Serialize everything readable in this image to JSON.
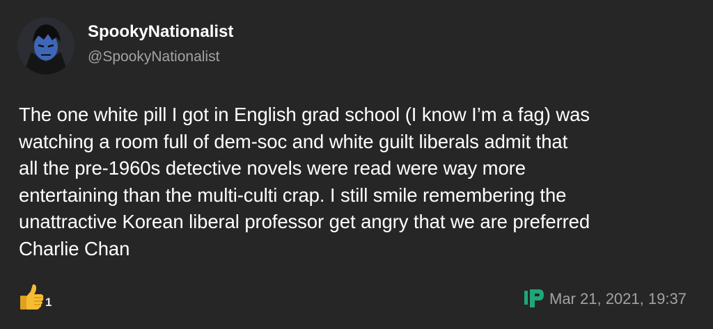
{
  "post": {
    "author": {
      "display_name": "SpookyNationalist",
      "handle": "@SpookyNationalist",
      "avatar_icon": "cartoon-vampire-avatar"
    },
    "text_lines": [
      "The one white pill I got in English grad school (I know I’m a fag) was",
      "watching a room full of dem-soc and white guilt liberals admit that",
      "all the pre-1960s detective novels were read were way more",
      "entertaining than the multi-culti crap. I still smile remembering the",
      "unattractive Korean liberal professor get angry that we are preferred",
      "Charlie Chan"
    ],
    "likes": {
      "icon": "thumbs-up-icon",
      "count": "1"
    },
    "source_icon": "parler-logo-icon",
    "timestamp": "Mar 21, 2021, 19:37"
  },
  "colors": {
    "background": "#262626",
    "text": "#ffffff",
    "secondary_text": "#a3a3a3",
    "thumb": "#f5b92e",
    "source_icon": "#1fa77a"
  }
}
